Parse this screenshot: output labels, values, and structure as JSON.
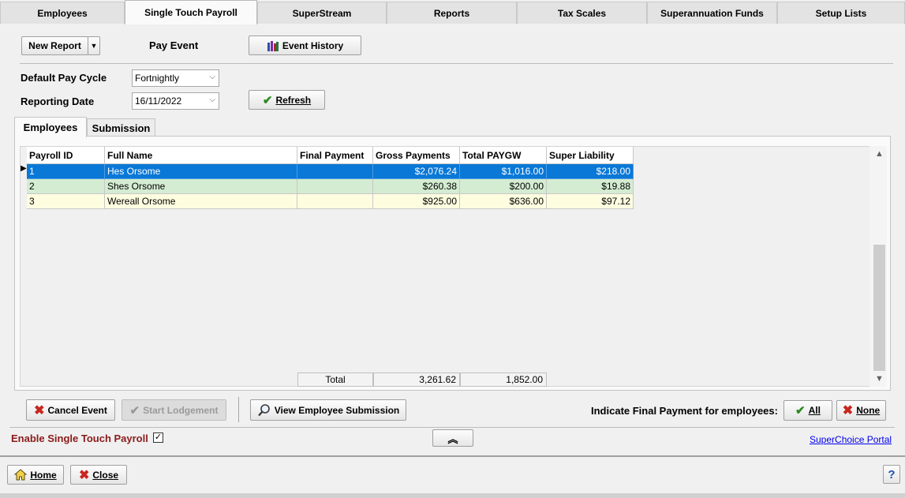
{
  "top_tabs": [
    {
      "label": "Employees"
    },
    {
      "label": "Single Touch Payroll"
    },
    {
      "label": "SuperStream"
    },
    {
      "label": "Reports"
    },
    {
      "label": "Tax Scales"
    },
    {
      "label": "Superannuation Funds"
    },
    {
      "label": "Setup Lists"
    }
  ],
  "toolbar": {
    "new_report": "New Report",
    "pay_event": "Pay Event",
    "event_history": "Event History"
  },
  "form": {
    "pay_cycle_label": "Default Pay Cycle",
    "pay_cycle_value": "Fortnightly",
    "reporting_date_label": "Reporting Date",
    "reporting_date_value": "16/11/2022",
    "refresh": "Refresh"
  },
  "inner_tabs": [
    {
      "label": "Employees"
    },
    {
      "label": "Submission"
    }
  ],
  "grid": {
    "columns": [
      "Payroll ID",
      "Full Name",
      "Final Payment",
      "Gross Payments",
      "Total PAYGW",
      "Super Liability"
    ],
    "rows": [
      {
        "id": "1",
        "name": "Hes Orsome",
        "final": "",
        "gross": "$2,076.24",
        "paygw": "$1,016.00",
        "super": "$218.00"
      },
      {
        "id": "2",
        "name": "Shes Orsome",
        "final": "",
        "gross": "$260.38",
        "paygw": "$200.00",
        "super": "$19.88"
      },
      {
        "id": "3",
        "name": "Wereall Orsome",
        "final": "",
        "gross": "$925.00",
        "paygw": "$636.00",
        "super": "$97.12"
      }
    ],
    "totals": {
      "label": "Total",
      "gross": "3,261.62",
      "paygw": "1,852.00"
    }
  },
  "actions": {
    "cancel_event": "Cancel Event",
    "start_lodgement": "Start Lodgement",
    "view_submission": "View Employee Submission",
    "final_payment_label": "Indicate Final Payment for employees:",
    "all": "All",
    "none": "None"
  },
  "footer": {
    "enable_stp": "Enable Single Touch Payroll",
    "superchoice": "SuperChoice Portal",
    "home": "Home",
    "close": "Close",
    "help": "?"
  },
  "colors": {
    "selected_row": "#0a78d7",
    "row_green": "#d4ecd2",
    "row_yellow": "#fefde0",
    "enable_label": "#8b1a1a"
  }
}
